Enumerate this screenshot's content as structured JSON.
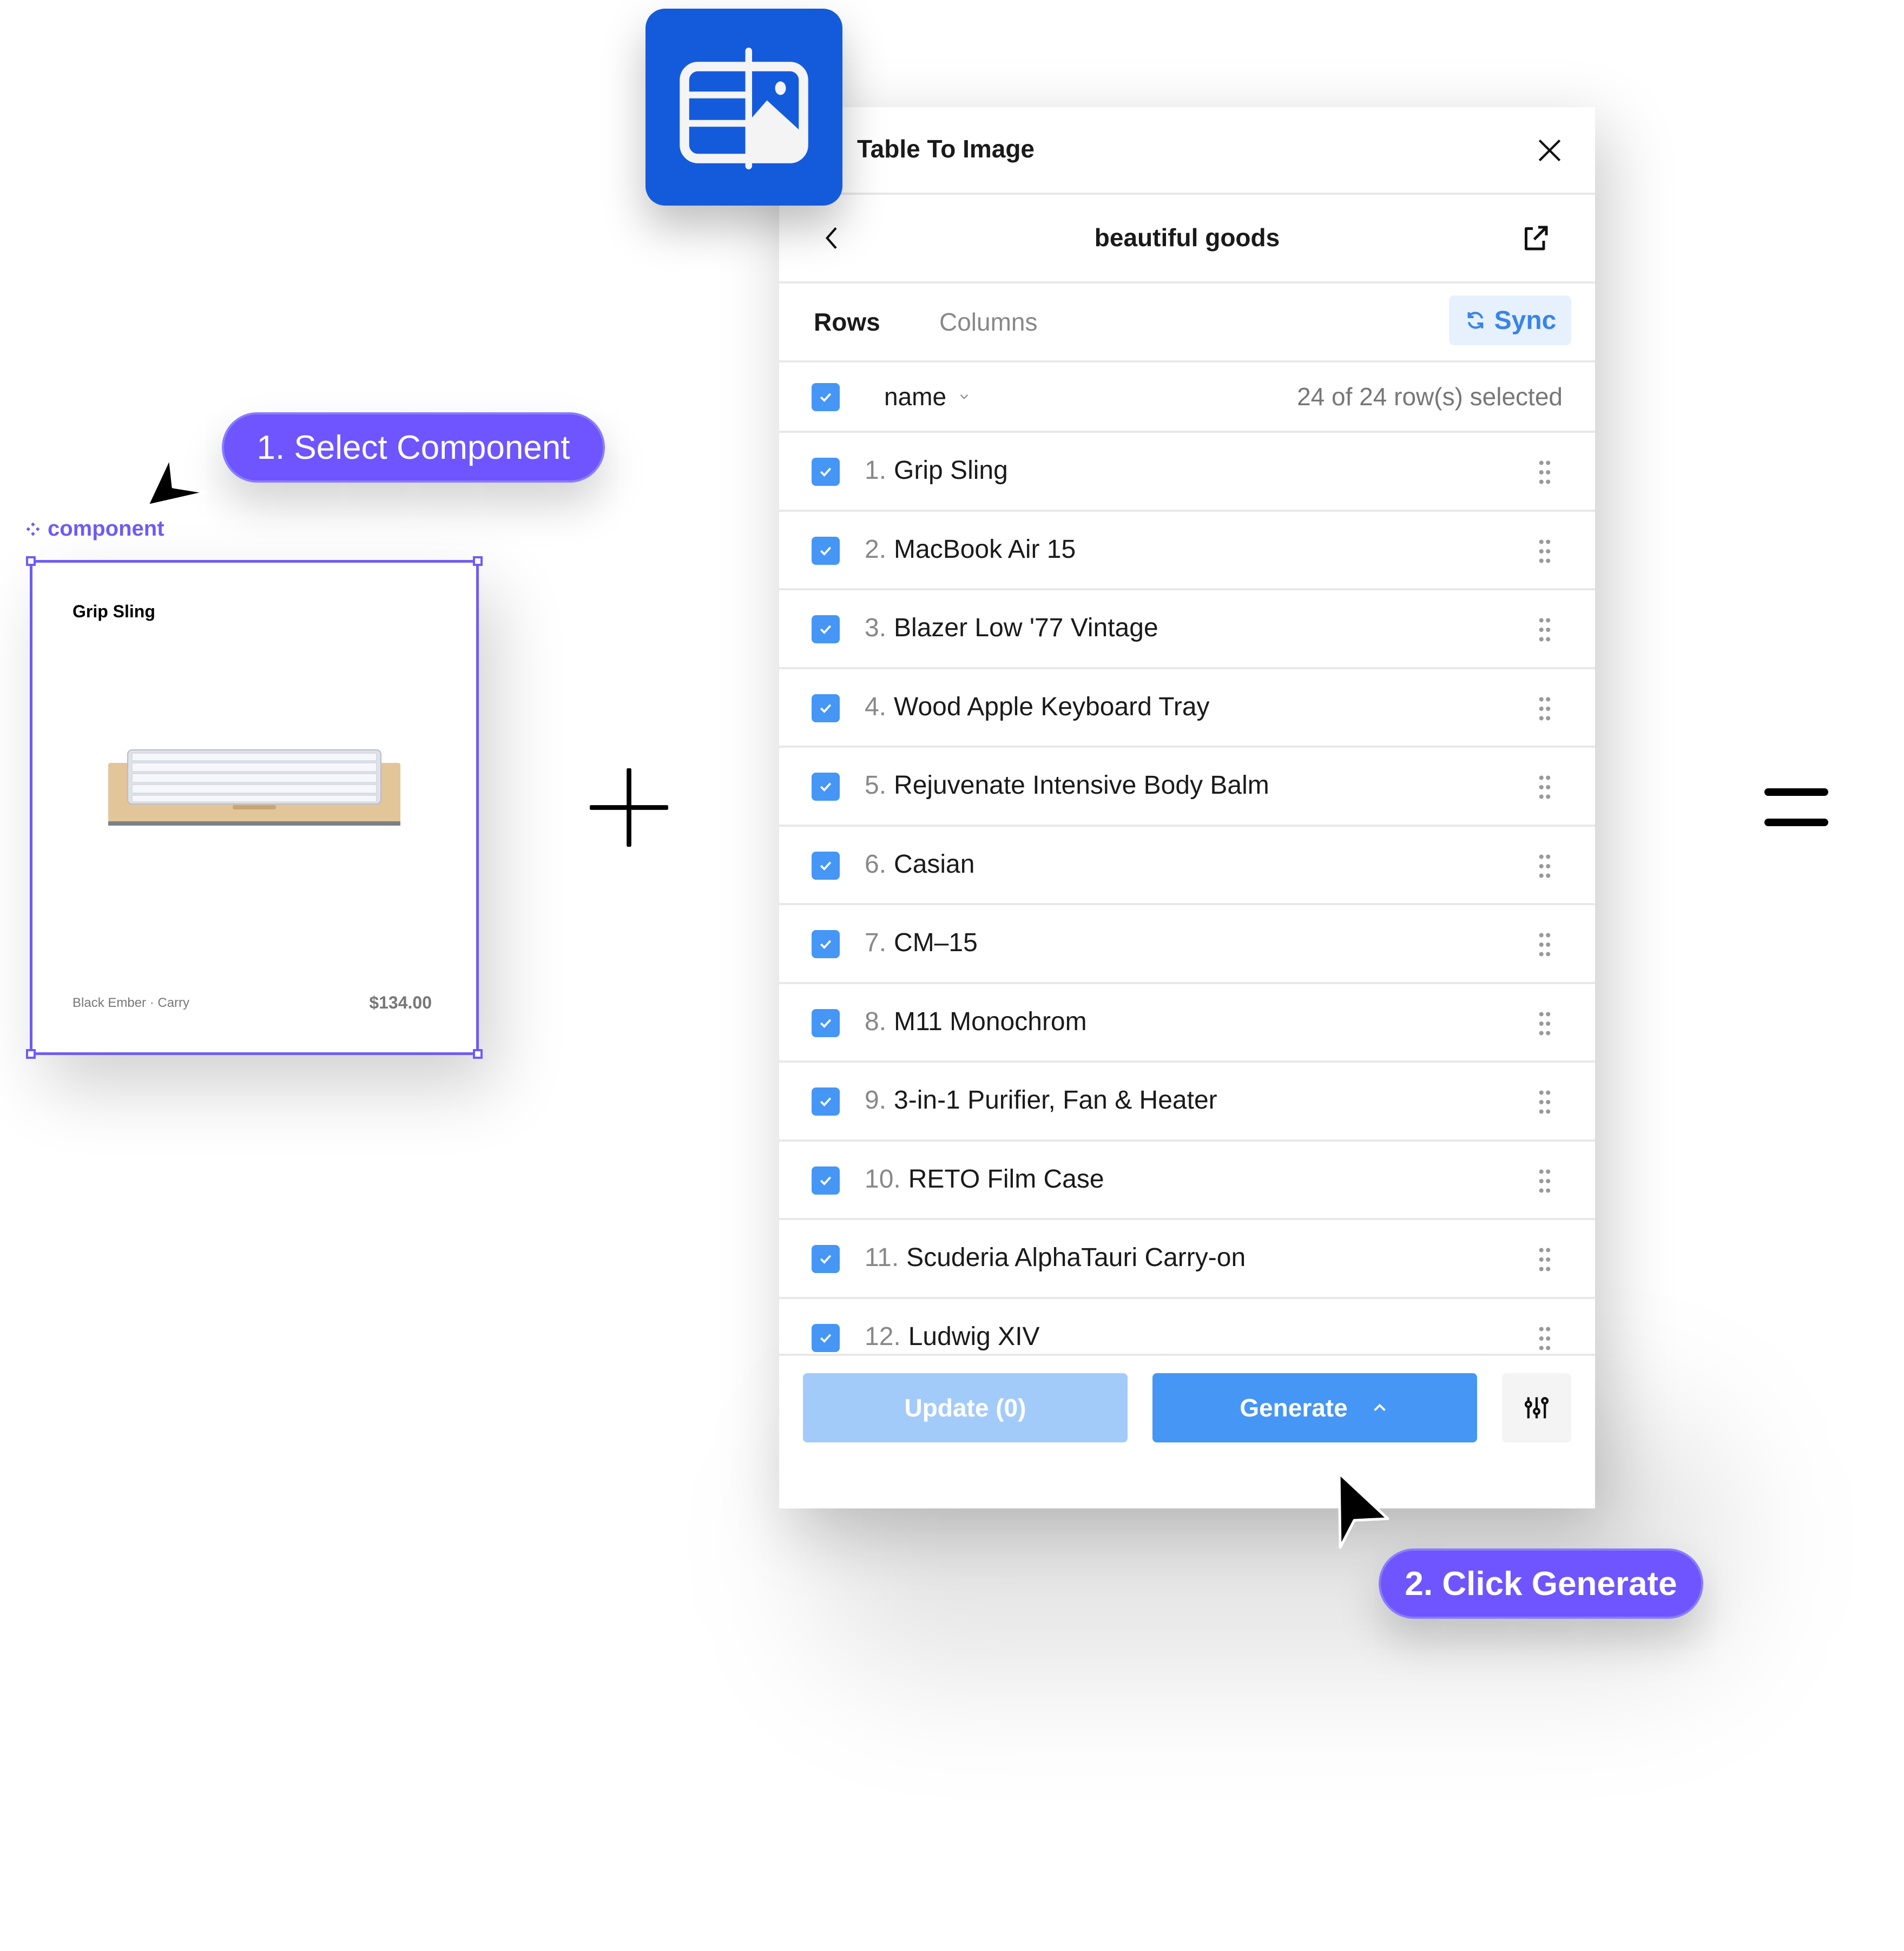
{
  "app": {
    "name": "Table To Image",
    "icon": "table-image-icon",
    "accent_color": "#145bdc"
  },
  "panel": {
    "title": "Table To Image",
    "close_icon": "close-icon",
    "nav": {
      "back_icon": "chevron-left-icon",
      "title": "beautiful goods",
      "open_icon": "external-link-icon"
    },
    "tabs": [
      {
        "label": "Rows",
        "active": true
      },
      {
        "label": "Columns",
        "active": false
      }
    ],
    "sync_label": "Sync",
    "header": {
      "column": "name",
      "selection": "24 of 24 row(s) selected",
      "checked": true
    },
    "rows": [
      {
        "index": "1.",
        "name": "Grip Sling",
        "checked": true
      },
      {
        "index": "2.",
        "name": "MacBook Air 15",
        "checked": true
      },
      {
        "index": "3.",
        "name": "Blazer Low '77 Vintage",
        "checked": true
      },
      {
        "index": "4.",
        "name": "Wood Apple Keyboard Tray",
        "checked": true
      },
      {
        "index": "5.",
        "name": "Rejuvenate Intensive Body Balm",
        "checked": true
      },
      {
        "index": "6.",
        "name": "Casian",
        "checked": true
      },
      {
        "index": "7.",
        "name": "CM–15",
        "checked": true
      },
      {
        "index": "8.",
        "name": "M11 Monochrom",
        "checked": true
      },
      {
        "index": "9.",
        "name": "3-in-1 Purifier, Fan & Heater",
        "checked": true
      },
      {
        "index": "10.",
        "name": "RETO Film Case",
        "checked": true
      },
      {
        "index": "11.",
        "name": "Scuderia AlphaTauri Carry-on",
        "checked": true
      },
      {
        "index": "12.",
        "name": "Ludwig XIV",
        "checked": true
      }
    ],
    "footer": {
      "update_label": "Update (0)",
      "generate_label": "Generate",
      "settings_icon": "sliders-icon"
    },
    "colors": {
      "primary": "#4596f5",
      "disabled": "#a3cbfa",
      "sync_bg": "#e6f1fd"
    }
  },
  "component": {
    "label": "component",
    "card": {
      "title": "Grip Sling",
      "meta": "Black Ember · Carry",
      "price": "$134.00"
    },
    "selection_color": "#6e5cf5"
  },
  "steps": {
    "step1": "1. Select Component",
    "step2": "2. Click Generate",
    "pill_color": "#6e55ff"
  },
  "operators": {
    "plus": "+",
    "equals": "="
  }
}
